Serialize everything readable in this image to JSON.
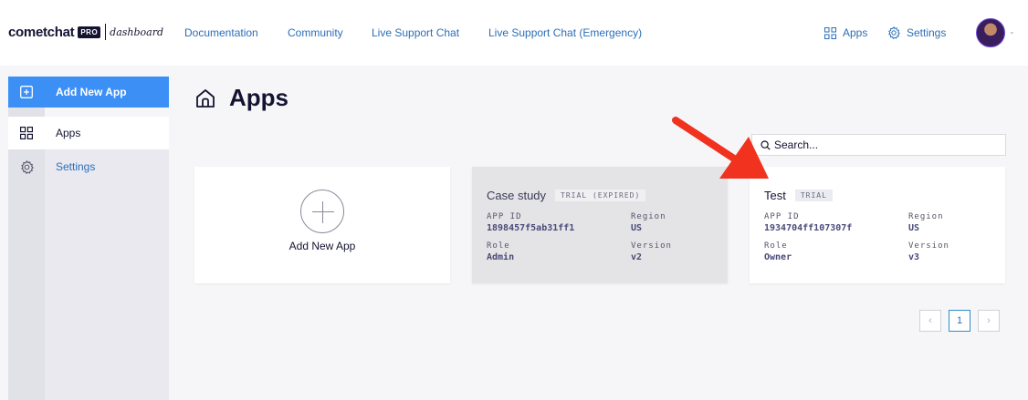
{
  "brand": {
    "name": "cometchat",
    "pro": "PRO",
    "sub": "dashboard"
  },
  "nav": [
    "Documentation",
    "Community",
    "Live Support Chat",
    "Live Support Chat (Emergency)"
  ],
  "header_right": {
    "apps": "Apps",
    "settings": "Settings",
    "caret": "⌄"
  },
  "sidebar": {
    "add_app": "Add New App",
    "items": [
      {
        "label": "Apps"
      },
      {
        "label": "Settings"
      }
    ]
  },
  "page": {
    "title": "Apps"
  },
  "search": {
    "placeholder": "Search..."
  },
  "new_app_card": {
    "label": "Add New App"
  },
  "apps": [
    {
      "name": "Case study",
      "badge": "TRIAL (EXPIRED)",
      "app_id_label": "APP ID",
      "app_id": "1898457f5ab31ff1",
      "region_label": "Region",
      "region": "US",
      "role_label": "Role",
      "role": "Admin",
      "version_label": "Version",
      "version": "v2"
    },
    {
      "name": "Test",
      "badge": "TRIAL",
      "app_id_label": "APP ID",
      "app_id": "1934704ff107307f",
      "region_label": "Region",
      "region": "US",
      "role_label": "Role",
      "role": "Owner",
      "version_label": "Version",
      "version": "v3"
    }
  ],
  "pagination": {
    "prev": "‹",
    "current": "1",
    "next": "›"
  },
  "colors": {
    "accent": "#3b8ff5",
    "link": "#2c6fb7",
    "arrow": "#f0321e"
  }
}
